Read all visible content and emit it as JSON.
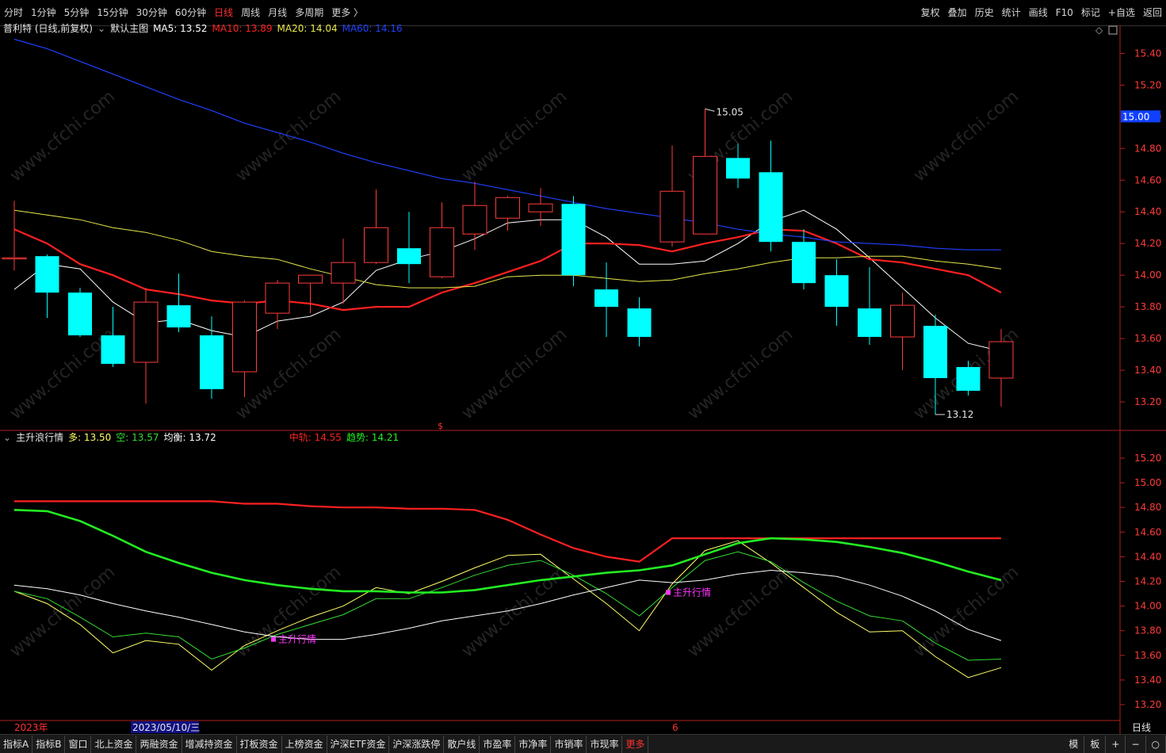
{
  "topbar": {
    "periods": [
      "分时",
      "1分钟",
      "5分钟",
      "15分钟",
      "30分钟",
      "60分钟",
      "日线",
      "周线",
      "月线",
      "多周期",
      "更多 〉"
    ],
    "active": "日线",
    "right": [
      "复权",
      "叠加",
      "历史",
      "统计",
      "画线",
      "F10",
      "标记",
      "+自选",
      "返回"
    ]
  },
  "main_legend": {
    "title": "普利特 (日线,前复权)",
    "chart_label": "默认主图",
    "ma5": "MA5: 13.52",
    "ma10": "MA10: 13.89",
    "ma20": "MA20: 14.04",
    "ma60": "MA60: 14.16"
  },
  "ind_legend": {
    "name": "主升浪行情",
    "duo": "多: 13.50",
    "kong": "空: 13.57",
    "balance": "均衡: 13.72",
    "mid": "中轨: 14.55",
    "trend": "趋势: 14.21"
  },
  "annotations": {
    "high": "15.05",
    "low": "13.12",
    "signal": "主升行情",
    "price_tag": "15.00",
    "year": "2023年",
    "date": "2023/05/10/三",
    "month_mark": "6",
    "period_label": "日线"
  },
  "watermark": "www.cfchi.com",
  "bottombar": {
    "tabs": [
      "指标A",
      "指标B",
      "窗口",
      "北上资金",
      "两融资金",
      "增减持资金",
      "打板资金",
      "上榜资金",
      "沪深ETF资金",
      "沪深涨跌停",
      "散户线",
      "市盈率",
      "市净率",
      "市销率",
      "市现率",
      "更多"
    ],
    "right": [
      "模",
      "板",
      "+",
      "−",
      "○"
    ]
  },
  "colors": {
    "up": "#ff3b3b",
    "down": "#00ffff",
    "ma5": "#ffffff",
    "ma10": "#ff2020",
    "ma20": "#e8e84a",
    "ma60": "#2040ff",
    "duo": "#ffff66",
    "kong": "#33dd33",
    "balance": "#ffffff",
    "mid": "#ff2020",
    "trend": "#22ee22",
    "signal": "#ff33ff"
  },
  "chart_data": [
    {
      "type": "candlestick",
      "title": "普利特 (日线,前复权)",
      "ylim": [
        13.1,
        15.55
      ],
      "yticks": [
        13.2,
        13.4,
        13.6,
        13.8,
        14.0,
        14.2,
        14.4,
        14.6,
        14.8,
        15.0,
        15.2,
        15.4
      ],
      "candles": [
        {
          "o": 14.11,
          "h": 14.47,
          "l": 14.03,
          "c": 14.11
        },
        {
          "o": 14.12,
          "h": 14.13,
          "l": 13.73,
          "c": 13.89
        },
        {
          "o": 13.89,
          "h": 13.92,
          "l": 13.61,
          "c": 13.62
        },
        {
          "o": 13.62,
          "h": 13.8,
          "l": 13.42,
          "c": 13.44
        },
        {
          "o": 13.45,
          "h": 13.92,
          "l": 13.19,
          "c": 13.83
        },
        {
          "o": 13.81,
          "h": 14.01,
          "l": 13.64,
          "c": 13.67
        },
        {
          "o": 13.62,
          "h": 13.74,
          "l": 13.22,
          "c": 13.28
        },
        {
          "o": 13.39,
          "h": 13.84,
          "l": 13.23,
          "c": 13.83
        },
        {
          "o": 13.76,
          "h": 13.97,
          "l": 13.66,
          "c": 13.95
        },
        {
          "o": 13.95,
          "h": 14.0,
          "l": 13.76,
          "c": 14.0
        },
        {
          "o": 13.95,
          "h": 14.23,
          "l": 13.82,
          "c": 14.08
        },
        {
          "o": 14.08,
          "h": 14.54,
          "l": 14.07,
          "c": 14.3
        },
        {
          "o": 14.17,
          "h": 14.4,
          "l": 13.95,
          "c": 14.07
        },
        {
          "o": 13.99,
          "h": 14.46,
          "l": 13.98,
          "c": 14.3
        },
        {
          "o": 14.26,
          "h": 14.59,
          "l": 14.16,
          "c": 14.44
        },
        {
          "o": 14.36,
          "h": 14.5,
          "l": 14.28,
          "c": 14.49
        },
        {
          "o": 14.4,
          "h": 14.55,
          "l": 14.31,
          "c": 14.45
        },
        {
          "o": 14.45,
          "h": 14.5,
          "l": 13.93,
          "c": 14.0
        },
        {
          "o": 13.91,
          "h": 14.08,
          "l": 13.61,
          "c": 13.8
        },
        {
          "o": 13.79,
          "h": 13.86,
          "l": 13.55,
          "c": 13.61
        },
        {
          "o": 14.21,
          "h": 14.82,
          "l": 14.18,
          "c": 14.53
        },
        {
          "o": 14.26,
          "h": 15.05,
          "l": 14.26,
          "c": 14.75
        },
        {
          "o": 14.74,
          "h": 14.83,
          "l": 14.55,
          "c": 14.61
        },
        {
          "o": 14.65,
          "h": 14.85,
          "l": 14.15,
          "c": 14.21
        },
        {
          "o": 14.21,
          "h": 14.29,
          "l": 13.91,
          "c": 13.95
        },
        {
          "o": 14.0,
          "h": 14.1,
          "l": 13.68,
          "c": 13.8
        },
        {
          "o": 13.79,
          "h": 14.05,
          "l": 13.56,
          "c": 13.61
        },
        {
          "o": 13.61,
          "h": 13.89,
          "l": 13.4,
          "c": 13.81
        },
        {
          "o": 13.68,
          "h": 13.75,
          "l": 13.12,
          "c": 13.35
        },
        {
          "o": 13.42,
          "h": 13.46,
          "l": 13.24,
          "c": 13.27
        },
        {
          "o": 13.35,
          "h": 13.66,
          "l": 13.17,
          "c": 13.58
        }
      ],
      "series": [
        {
          "name": "MA5",
          "values": [
            13.91,
            14.07,
            14.04,
            13.83,
            13.7,
            13.72,
            13.65,
            13.61,
            13.71,
            13.74,
            13.83,
            14.03,
            14.1,
            14.15,
            14.23,
            14.33,
            14.35,
            14.35,
            14.24,
            14.07,
            14.07,
            14.09,
            14.2,
            14.34,
            14.41,
            14.29,
            14.11,
            13.92,
            13.73,
            13.57,
            13.52
          ]
        },
        {
          "name": "MA10",
          "values": [
            14.29,
            14.2,
            14.07,
            14.0,
            13.91,
            13.88,
            13.84,
            13.82,
            13.84,
            13.82,
            13.78,
            13.8,
            13.8,
            13.89,
            13.95,
            14.02,
            14.09,
            14.2,
            14.2,
            14.19,
            14.15,
            14.2,
            14.24,
            14.29,
            14.28,
            14.2,
            14.1,
            14.08,
            14.04,
            14.0,
            13.89
          ]
        },
        {
          "name": "MA20",
          "values": [
            14.41,
            14.38,
            14.35,
            14.3,
            14.27,
            14.22,
            14.15,
            14.12,
            14.1,
            14.04,
            13.99,
            13.94,
            13.92,
            13.92,
            13.93,
            13.99,
            14.0,
            14.0,
            13.98,
            13.96,
            13.97,
            14.01,
            14.04,
            14.08,
            14.11,
            14.11,
            14.12,
            14.12,
            14.09,
            14.07,
            14.04
          ]
        },
        {
          "name": "MA60",
          "values": [
            15.49,
            15.43,
            15.35,
            15.27,
            15.19,
            15.11,
            15.04,
            14.96,
            14.9,
            14.84,
            14.77,
            14.71,
            14.66,
            14.61,
            14.58,
            14.54,
            14.5,
            14.46,
            14.42,
            14.39,
            14.36,
            14.33,
            14.29,
            14.26,
            14.24,
            14.21,
            14.2,
            14.19,
            14.17,
            14.16,
            14.16
          ]
        }
      ]
    },
    {
      "type": "line",
      "title": "主升浪行情",
      "ylim": [
        13.1,
        15.35
      ],
      "yticks": [
        13.2,
        13.4,
        13.6,
        13.8,
        14.0,
        14.2,
        14.4,
        14.6,
        14.8,
        15.0,
        15.2
      ],
      "series": [
        {
          "name": "多",
          "values": [
            14.12,
            14.02,
            13.85,
            13.62,
            13.72,
            13.69,
            13.48,
            13.68,
            13.8,
            13.91,
            14.0,
            14.15,
            14.1,
            14.2,
            14.31,
            14.41,
            14.42,
            14.22,
            14.02,
            13.8,
            14.18,
            14.45,
            14.53,
            14.35,
            14.15,
            13.95,
            13.79,
            13.8,
            13.59,
            13.42,
            13.5
          ]
        },
        {
          "name": "空",
          "values": [
            14.12,
            14.06,
            13.91,
            13.75,
            13.78,
            13.75,
            13.57,
            13.66,
            13.77,
            13.85,
            13.93,
            14.06,
            14.06,
            14.15,
            14.25,
            14.33,
            14.37,
            14.25,
            14.1,
            13.92,
            14.15,
            14.37,
            14.44,
            14.36,
            14.19,
            14.04,
            13.92,
            13.88,
            13.7,
            13.56,
            13.57
          ]
        },
        {
          "name": "均衡",
          "values": [
            14.17,
            14.14,
            14.09,
            14.02,
            13.96,
            13.91,
            13.85,
            13.79,
            13.75,
            13.73,
            13.73,
            13.77,
            13.82,
            13.88,
            13.92,
            13.96,
            14.02,
            14.09,
            14.15,
            14.21,
            14.19,
            14.21,
            14.26,
            14.29,
            14.27,
            14.24,
            14.17,
            14.08,
            13.96,
            13.81,
            13.72
          ]
        },
        {
          "name": "中轨",
          "values": [
            14.85,
            14.85,
            14.85,
            14.85,
            14.85,
            14.85,
            14.85,
            14.83,
            14.83,
            14.81,
            14.8,
            14.8,
            14.79,
            14.79,
            14.78,
            14.7,
            14.58,
            14.47,
            14.4,
            14.36,
            14.55,
            14.55,
            14.55,
            14.55,
            14.55,
            14.55,
            14.55,
            14.55,
            14.55,
            14.55,
            14.55
          ]
        },
        {
          "name": "趋势",
          "values": [
            14.78,
            14.77,
            14.69,
            14.57,
            14.44,
            14.35,
            14.27,
            14.21,
            14.17,
            14.14,
            14.12,
            14.12,
            14.11,
            14.11,
            14.13,
            14.17,
            14.21,
            14.24,
            14.27,
            14.29,
            14.33,
            14.42,
            14.51,
            14.55,
            14.54,
            14.52,
            14.48,
            14.43,
            14.36,
            14.28,
            14.21
          ]
        }
      ]
    }
  ]
}
